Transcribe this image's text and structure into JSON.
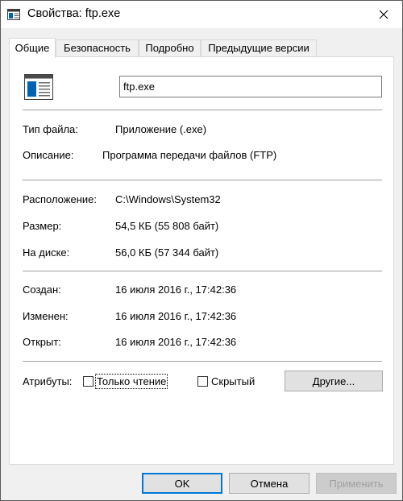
{
  "window": {
    "title": "Свойства: ftp.exe"
  },
  "tabs": [
    {
      "label": "Общие",
      "active": true
    },
    {
      "label": "Безопасность",
      "active": false
    },
    {
      "label": "Подробно",
      "active": false
    },
    {
      "label": "Предыдущие версии",
      "active": false
    }
  ],
  "general": {
    "file_name": "ftp.exe",
    "type_label": "Тип файла:",
    "type_value": "Приложение (.exe)",
    "description_label": "Описание:",
    "description_value": "Программа передачи файлов (FTP)",
    "location_label": "Расположение:",
    "location_value": "C:\\Windows\\System32",
    "size_label": "Размер:",
    "size_value": "54,5 КБ (55 808 байт)",
    "disk_label": "На диске:",
    "disk_value": "56,0 КБ (57 344 байт)",
    "created_label": "Создан:",
    "created_value": "16 июля 2016 г., 17:42:36",
    "modified_label": "Изменен:",
    "modified_value": "16 июля 2016 г., 17:42:36",
    "accessed_label": "Открыт:",
    "accessed_value": "16 июля 2016 г., 17:42:36",
    "attributes_label": "Атрибуты:",
    "readonly_label": "Только чтение",
    "readonly_checked": false,
    "hidden_label": "Скрытый",
    "hidden_checked": false,
    "other_button": "Другие..."
  },
  "footer": {
    "ok": "OK",
    "cancel": "Отмена",
    "apply": "Применить"
  },
  "colors": {
    "accent": "#0078d7",
    "file_icon_blue": "#0063b1",
    "disabled_text": "#a0a0a0"
  }
}
